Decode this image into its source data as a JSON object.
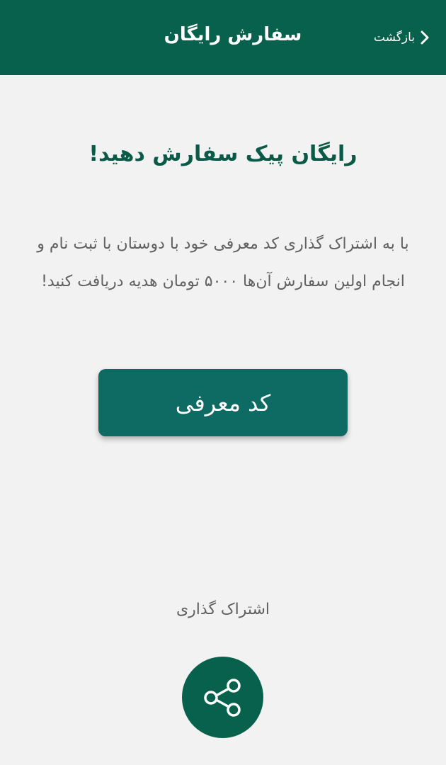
{
  "header": {
    "title": "سفارش رایگان",
    "back_label": "بازگشت"
  },
  "main": {
    "headline": "رایگان پیک سفارش دهید!",
    "description": "با به اشتراک گذاری کد معرفی خود با دوستان با ثبت نام و انجام اولین سفارش آن‌ها ۵۰۰۰ تومان هدیه دریافت کنید!",
    "referral_button_label": "کد معرفی",
    "share_label": "اشتراک گذاری"
  },
  "icons": {
    "back": "chevron-right-icon",
    "share": "share-icon"
  },
  "colors": {
    "header_bg": "#07614c",
    "headline": "#0b5a48",
    "button_bg": "#0d6b63",
    "background": "#f2f2f2",
    "body_text": "#616161"
  }
}
